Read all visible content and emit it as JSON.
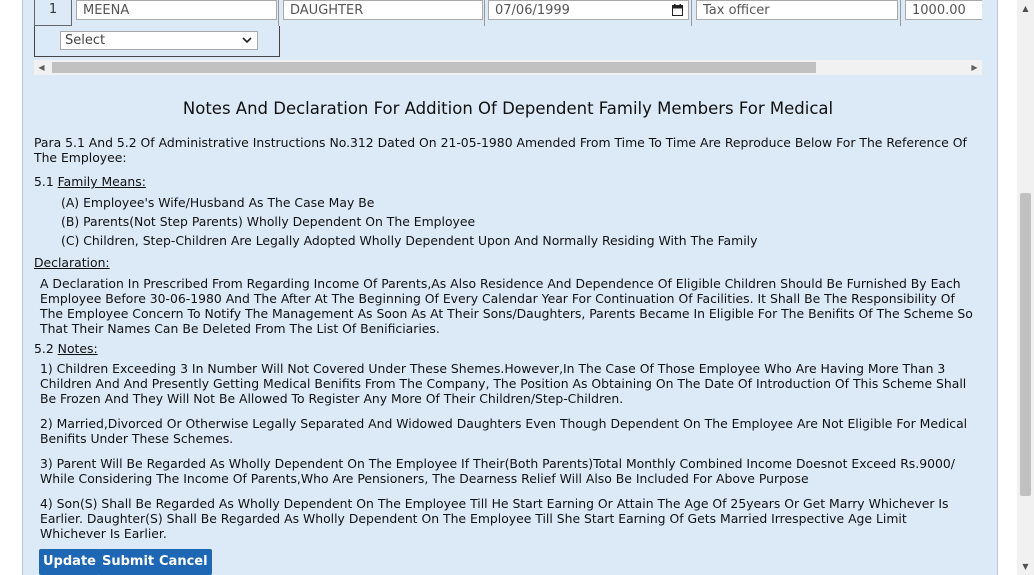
{
  "table_row": {
    "index": "1",
    "name": "MEENA",
    "relation": "DAUGHTER",
    "dob": "07/06/1999",
    "occupation": "Tax officer",
    "income": "1000.00",
    "select_value": "Select"
  },
  "notes": {
    "title": "Notes And Declaration For Addition Of Dependent Family Members For Medical",
    "intro": "Para 5.1 And 5.2 Of Administrative Instructions No.312 Dated On 21-05-1980 Amended From Time To Time Are Reproduce Below For The Reference Of The Employee:",
    "family_prefix": "5.1",
    "family_heading": "Family Means:",
    "family_items": [
      "(A) Employee's Wife/Husband As The Case May Be",
      "(B) Parents(Not Step Parents) Wholly Dependent On The Employee",
      "(C) Children, Step-Children Are Legally Adopted Wholly Dependent Upon And Normally Residing With The Family"
    ],
    "declaration_heading": "Declaration:",
    "declaration_text": "A Declaration In Prescribed From Regarding Income Of Parents,As Also Residence And Dependence Of Eligible Children Should Be Furnished By Each Employee Before 30-06-1980 And The After At The Beginning Of Every Calendar Year For Continuation Of Facilities. It Shall Be The Responsibility Of The Employee Concern To Notify The Management As Soon As At Their Sons/Daughters, Parents Became In Eligible For The Benifits Of The Scheme So That Their Names Can Be Deleted From The List Of Benificiaries.",
    "notes_prefix": "5.2",
    "notes_heading": "Notes:",
    "notes_items": [
      "1) Children Exceeding 3 In Number Will Not Covered Under These Shemes.However,In The Case Of Those Employee Who Are Having More Than 3 Children And And Presently Getting Medical Benifits From The Company, The Position As Obtaining On The Date Of Introduction Of This Scheme Shall Be Frozen And They Will Not Be Allowed To Register Any More Of Their Children/Step-Children.",
      "2) Married,Divorced Or Otherwise Legally Separated And Widowed Daughters Even Though Dependent On The Employee Are Not Eligible For Medical Benifits Under These Schemes.",
      "3) Parent Will Be Regarded As Wholly Dependent On The Employee If Their(Both Parents)Total Monthly Combined Income Doesnot Exceed Rs.9000/ While Considering The Income Of Parents,Who Are Pensioners, The Dearness Relief Will Also Be Included For Above Purpose",
      "4) Son(S) Shall Be Regarded As Wholly Dependent On The Employee Till He Start Earning Or Attain The Age Of 25years Or Get Marry Whichever Is Earlier. Daughter(S) Shall Be Regarded As Wholly Dependent On The Employee Till She Start Earning Of Gets Married Irrespective Age Limit Whichever Is Earlier."
    ]
  },
  "buttons": {
    "update": "Update",
    "submit": "Submit",
    "cancel": "Cancel"
  },
  "icons": {
    "calendar": "calendar-icon",
    "dropdown": "chevron-down-icon",
    "scroll_left": "triangle-left-icon",
    "scroll_right": "triangle-right-icon",
    "scroll_up": "triangle-up-icon",
    "scroll_down": "triangle-down-icon"
  },
  "colors": {
    "panel_bg": "#dce9f7",
    "button_bg": "#1e67b4"
  }
}
